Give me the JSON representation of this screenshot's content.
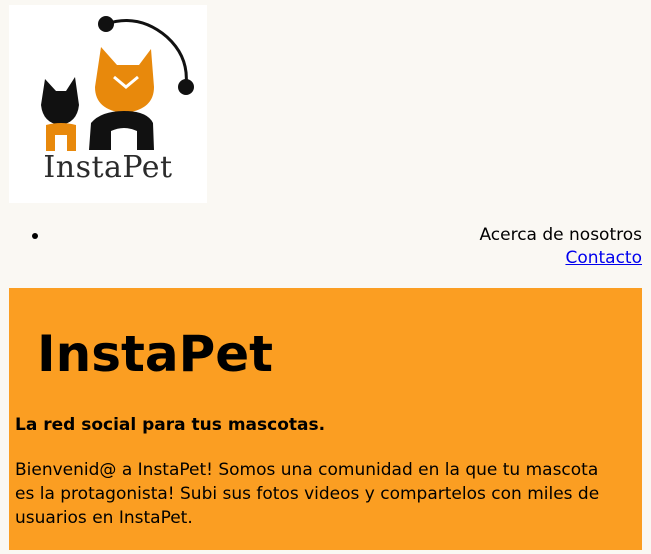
{
  "logo": {
    "text": "InstaPet",
    "colors": {
      "orange": "#e8890c",
      "black": "#111111",
      "text": "#2b2b2b"
    }
  },
  "nav": {
    "items": [
      {
        "label": "Acerca de nosotros",
        "is_link": false
      },
      {
        "label": "Contacto",
        "is_link": true
      }
    ]
  },
  "hero": {
    "title": "InstaPet",
    "subtitle": "La red social para tus mascotas.",
    "body": "Bienvenid@ a InstaPet! Somos una comunidad en la que tu mascota es la protagonista! Subi sus fotos videos y compartelos con miles de usuarios en InstaPet.",
    "background": "#fb9e22"
  }
}
